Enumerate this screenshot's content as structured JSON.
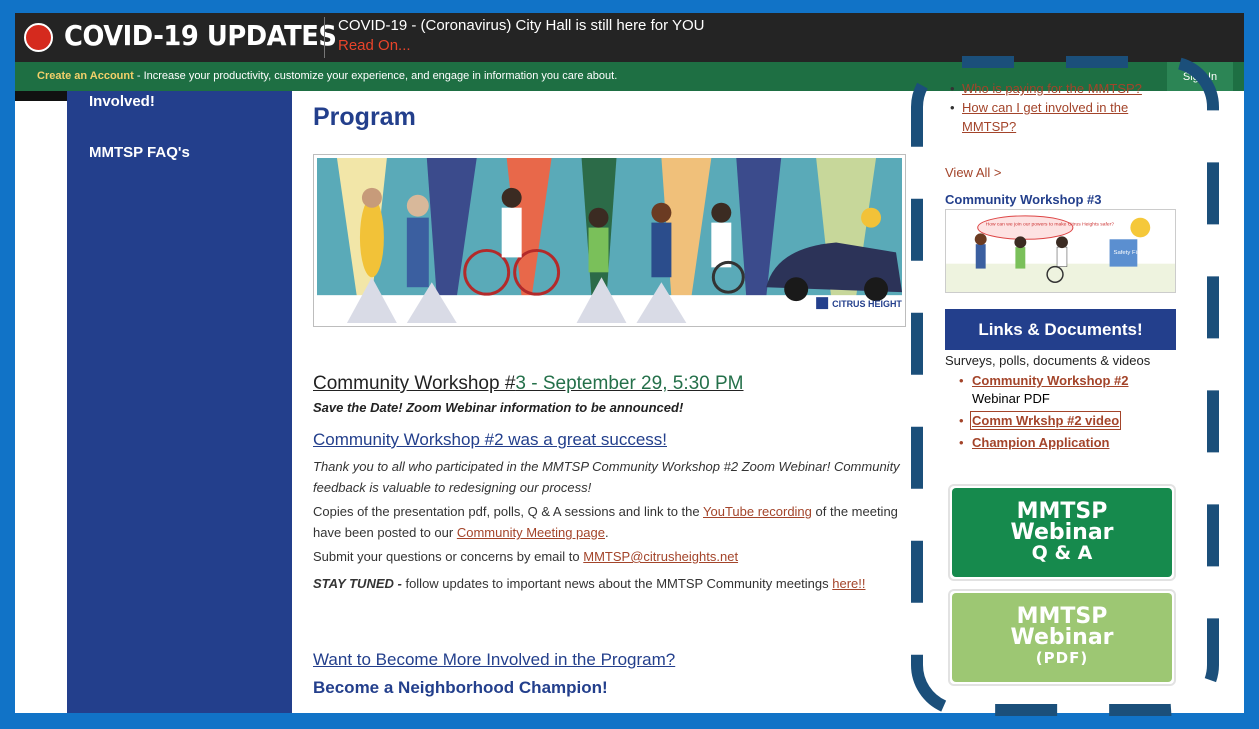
{
  "covid": {
    "title": "COVID-19 UPDATES",
    "message": "COVID-19 - (Coronavirus) City Hall is still here for YOU",
    "read_on": "Read On..."
  },
  "account_bar": {
    "create_account": "Create an Account",
    "description": " - Increase your productivity, customize your experience, and engage in information you care about.",
    "sign_in": "Sign In"
  },
  "sidebar": {
    "items": [
      {
        "label": "Involved!"
      },
      {
        "label": "MMTSP FAQ's"
      }
    ]
  },
  "main": {
    "page_title": "Program",
    "banner_logo": "CITRUS HEIGHTS",
    "workshop3_prefix": "Community Workshop #",
    "workshop3_rest": "3 - September 29, 5:30 PM",
    "save_date": "Save the Date! Zoom Webinar information to be announced!",
    "success_heading": "Community Workshop #2 was a great success!",
    "thanks_text": "Thank you to all who participated in the MMTSP Community Workshop #2 Zoom Webinar! Community feedback is valuable to redesigning our process!",
    "copies_text_1": "Copies of the presentation pdf, polls, Q & A sessions and link to the ",
    "youtube_link": "YouTube recording",
    "copies_text_2": " of the meeting have been posted to our ",
    "community_meeting_link": "Community Meeting page",
    "copies_text_3": ".",
    "submit_text": "Submit your questions or concerns by email to ",
    "email_link": "MMTSP@citrusheights.net",
    "stay_tuned_bold": "STAY TUNED - ",
    "stay_tuned_text": "follow updates to important news about the MMTSP Community meetings ",
    "here_link": "here!!",
    "more_involved_heading": "Want to Become More Involved in the Program?",
    "champion_heading": "Become a Neighborhood Champion!"
  },
  "right": {
    "faq_items": [
      {
        "label": "Who is paying for the MMTSP?"
      },
      {
        "label": "How can I get involved in the MMTSP?"
      }
    ],
    "view_all": "View All >",
    "cw3_title": "Community Workshop #3",
    "cw3_bubble": "How can we join our powers to make Citrus Heights safer?",
    "cw3_sign": "Safety First",
    "links_heading": "Links & Documents!",
    "links_sub": "Surveys, polls, documents & videos",
    "docs": [
      {
        "label": "Community Workshop #2",
        "suffix": "Webinar PDF"
      },
      {
        "label": "Comm Wrkshp #2 video",
        "suffix": ""
      },
      {
        "label": "Champion Application",
        "suffix": ""
      }
    ],
    "qa_button": {
      "line1": "MMTSP",
      "line2": "Webinar",
      "line3": "Q & A"
    },
    "pdf_button": {
      "line1": "MMTSP",
      "line2": "Webinar",
      "line3": "(PDF)"
    }
  },
  "colors": {
    "frame_blue": "#1173c7",
    "covid_bg": "#242424",
    "green_bar": "#1e6f43",
    "sidebar": "#233f8c",
    "link": "#a3442a",
    "qa_green": "#168a4d",
    "pdf_green": "#9dc773",
    "dash_navy": "#1b4f7a"
  }
}
